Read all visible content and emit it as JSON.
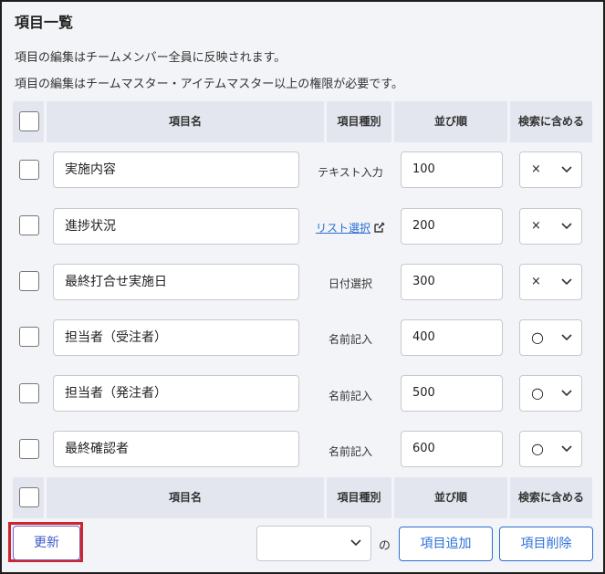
{
  "page": {
    "title": "項目一覧",
    "desc1": "項目の編集はチームメンバー全員に反映されます。",
    "desc2": "項目の編集はチームマスター・アイテムマスター以上の権限が必要です。"
  },
  "table": {
    "headers": {
      "name": "項目名",
      "type": "項目種別",
      "order": "並び順",
      "search": "検索に含める"
    },
    "rows": [
      {
        "name": "実施内容",
        "type": "テキスト入力",
        "type_is_link": false,
        "order": "100",
        "search": "×"
      },
      {
        "name": "進捗状況",
        "type": "リスト選択",
        "type_is_link": true,
        "order": "200",
        "search": "×"
      },
      {
        "name": "最終打合せ実施日",
        "type": "日付選択",
        "type_is_link": false,
        "order": "300",
        "search": "×"
      },
      {
        "name": "担当者（受注者）",
        "type": "名前記入",
        "type_is_link": false,
        "order": "400",
        "search": "○"
      },
      {
        "name": "担当者（発注者）",
        "type": "名前記入",
        "type_is_link": false,
        "order": "500",
        "search": "○"
      },
      {
        "name": "最終確認者",
        "type": "名前記入",
        "type_is_link": false,
        "order": "600",
        "search": "○"
      }
    ]
  },
  "footer": {
    "update_label": "更新",
    "count_selected": "",
    "no_label": "の",
    "add_label": "項目追加",
    "delete_label": "項目削除"
  },
  "colors": {
    "accent": "#2a6fd8",
    "header_bg": "#e3e6ef",
    "page_bg": "#f3f4f7",
    "highlight": "#d0242f"
  },
  "icons": {
    "edit": "edit-icon",
    "dropdown": "chevron-down-icon"
  }
}
